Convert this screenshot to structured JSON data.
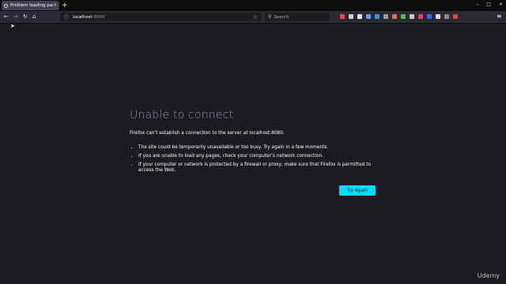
{
  "tab": {
    "title": "Problem loading page",
    "close": "×",
    "new_tab": "+"
  },
  "window_controls": {
    "minimize": "–",
    "maximize": "□",
    "close": "×"
  },
  "nav": {
    "back": "←",
    "forward": "→",
    "reload": "↻",
    "home": "⌂"
  },
  "url": {
    "host": "localhost",
    "port": ":8080",
    "info_icon": "ⓘ",
    "bookmark": "☆"
  },
  "search": {
    "icon": "⚲",
    "placeholder": "Search"
  },
  "toolbar_icons": [
    {
      "name": "pocket-icon",
      "color": "#ef4056"
    },
    {
      "name": "downloads-icon",
      "color": "#cfcfd8"
    },
    {
      "name": "extension-icon",
      "color": "#e6e6ea"
    },
    {
      "name": "extension-icon",
      "color": "#5aa2ff"
    },
    {
      "name": "extension-icon",
      "color": "#2b9bd6"
    },
    {
      "name": "extension-icon",
      "color": "#9a9aa8"
    },
    {
      "name": "extension-icon",
      "color": "#e27340"
    },
    {
      "name": "extension-icon",
      "color": "#4fbf4a"
    },
    {
      "name": "extension-icon",
      "color": "#c9c9d1"
    },
    {
      "name": "extension-icon",
      "color": "#e33d6d"
    },
    {
      "name": "extension-icon",
      "color": "#3366ff"
    },
    {
      "name": "extension-icon",
      "color": "#d9d9de"
    },
    {
      "name": "extension-icon",
      "color": "#8a8a96"
    },
    {
      "name": "extension-icon",
      "color": "#c34a4a"
    }
  ],
  "menu": "≡",
  "error": {
    "title": "Unable to connect",
    "description": "Firefox can’t establish a connection to the server at localhost:8080.",
    "bullets": [
      "The site could be temporarily unavailable or too busy. Try again in a few moments.",
      "If you are unable to load any pages, check your computer’s network connection.",
      "If your computer or network is protected by a firewall or proxy, make sure that Firefox is permitted to access the Web."
    ],
    "button": "Try Again"
  },
  "watermark": "Udemy"
}
